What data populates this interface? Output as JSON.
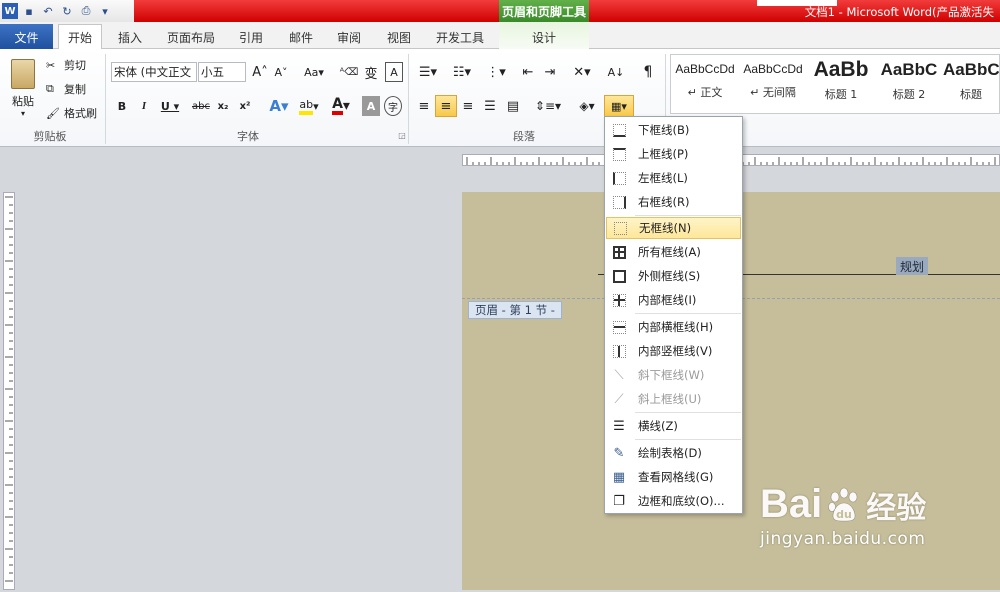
{
  "quick_access": {
    "icons": [
      "word-icon",
      "save-icon",
      "undo-icon",
      "redo-icon",
      "print-preview-icon",
      "customize-icon"
    ]
  },
  "title_bar": {
    "context_tool": "页眉和页脚工具",
    "doc_title": "文档1 - Microsoft Word(产品激活失"
  },
  "tabs": {
    "file": "文件",
    "home": "开始",
    "insert": "插入",
    "page_layout": "页面布局",
    "references": "引用",
    "mailings": "邮件",
    "review": "审阅",
    "view": "视图",
    "developer": "开发工具",
    "design": "设计"
  },
  "clipboard": {
    "paste": "粘贴",
    "cut": "剪切",
    "copy": "复制",
    "format_painter": "格式刷",
    "group": "剪贴板"
  },
  "font": {
    "name": "宋体 (中文正文",
    "size": "小五",
    "group": "字体"
  },
  "paragraph": {
    "group": "段落"
  },
  "styles": [
    {
      "sample": "AaBbCcDd",
      "name": "↵ 正文"
    },
    {
      "sample": "AaBbCcDd",
      "name": "↵ 无间隔"
    },
    {
      "sample": "AaBb",
      "name": "标题 1"
    },
    {
      "sample": "AaBbC",
      "name": "标题 2"
    },
    {
      "sample": "AaBbC",
      "name": "标题"
    }
  ],
  "document": {
    "header_text": "规划",
    "header_tag": "页眉 - 第 1 节 -"
  },
  "border_menu": {
    "items": [
      {
        "label": "下框线(B)",
        "icon": "bottom-border-icon"
      },
      {
        "label": "上框线(P)",
        "icon": "top-border-icon"
      },
      {
        "label": "左框线(L)",
        "icon": "left-border-icon"
      },
      {
        "label": "右框线(R)",
        "icon": "right-border-icon"
      },
      {
        "label": "无框线(N)",
        "icon": "no-border-icon"
      },
      {
        "label": "所有框线(A)",
        "icon": "all-borders-icon"
      },
      {
        "label": "外侧框线(S)",
        "icon": "outside-borders-icon"
      },
      {
        "label": "内部框线(I)",
        "icon": "inside-borders-icon"
      },
      {
        "label": "内部横框线(H)",
        "icon": "inside-horizontal-border-icon"
      },
      {
        "label": "内部竖框线(V)",
        "icon": "inside-vertical-border-icon"
      },
      {
        "label": "斜下框线(W)",
        "icon": "diagonal-down-border-icon"
      },
      {
        "label": "斜上框线(U)",
        "icon": "diagonal-up-border-icon"
      },
      {
        "label": "横线(Z)",
        "icon": "horizontal-line-icon"
      },
      {
        "label": "绘制表格(D)",
        "icon": "draw-table-icon"
      },
      {
        "label": "查看网格线(G)",
        "icon": "view-gridlines-icon"
      },
      {
        "label": "边框和底纹(O)...",
        "icon": "borders-shading-icon"
      }
    ]
  },
  "watermark": {
    "brand": "Bai",
    "cn": "经验",
    "url": "jingyan.baidu.com"
  },
  "colors": {
    "title_red": "#e00000",
    "context_green": "#4a9b36",
    "file_blue": "#2b5fb3",
    "page_bg": "#c6be9a",
    "highlight": "#fde79a"
  }
}
